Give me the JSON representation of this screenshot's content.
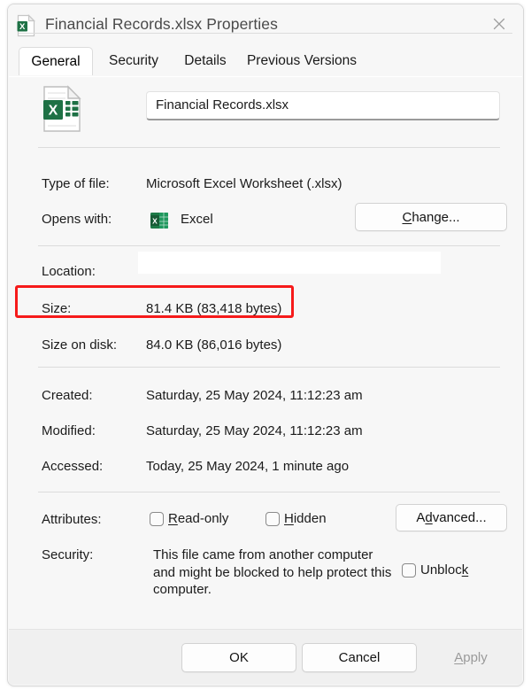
{
  "window": {
    "title": "Financial Records.xlsx Properties",
    "title_icon": "excel-document-icon",
    "close_icon": "close-icon"
  },
  "tabs": [
    {
      "label": "General",
      "active": true
    },
    {
      "label": "Security",
      "active": false
    },
    {
      "label": "Details",
      "active": false
    },
    {
      "label": "Previous Versions",
      "active": false
    }
  ],
  "general": {
    "file_icon": "excel-document-icon",
    "file_name": "Financial Records.xlsx",
    "type_of_file_label": "Type of file:",
    "type_of_file_value": "Microsoft Excel Worksheet (.xlsx)",
    "opens_with_label": "Opens with:",
    "opens_with_icon": "excel-app-icon",
    "opens_with_value": "Excel",
    "change_button": "Change...",
    "change_button_accel": "C",
    "location_label": "Location:",
    "location_value": "",
    "size_label": "Size:",
    "size_value": "81.4 KB (83,418 bytes)",
    "size_on_disk_label": "Size on disk:",
    "size_on_disk_value": "84.0 KB (86,016 bytes)",
    "created_label": "Created:",
    "created_value": "Saturday, 25 May 2024, 11:12:23 am",
    "modified_label": "Modified:",
    "modified_value": "Saturday, 25 May 2024, 11:12:23 am",
    "accessed_label": "Accessed:",
    "accessed_value": "Today, 25 May 2024, 1 minute ago",
    "attributes_label": "Attributes:",
    "readonly_label": "Read-only",
    "readonly_accel": "R",
    "readonly_checked": false,
    "hidden_label": "Hidden",
    "hidden_accel": "H",
    "hidden_checked": false,
    "advanced_button": "Advanced...",
    "advanced_button_accel": "d",
    "security_label": "Security:",
    "security_text": "This file came from another computer and might be blocked to help protect this computer.",
    "unblock_label": "Unblock",
    "unblock_accel": "k",
    "unblock_checked": false
  },
  "footer": {
    "ok_button": "OK",
    "cancel_button": "Cancel",
    "apply_button": "Apply",
    "apply_accel": "A",
    "apply_disabled": true
  },
  "annotation": {
    "highlight_color": "#f61a1a",
    "highlighted_field": "Size:"
  }
}
